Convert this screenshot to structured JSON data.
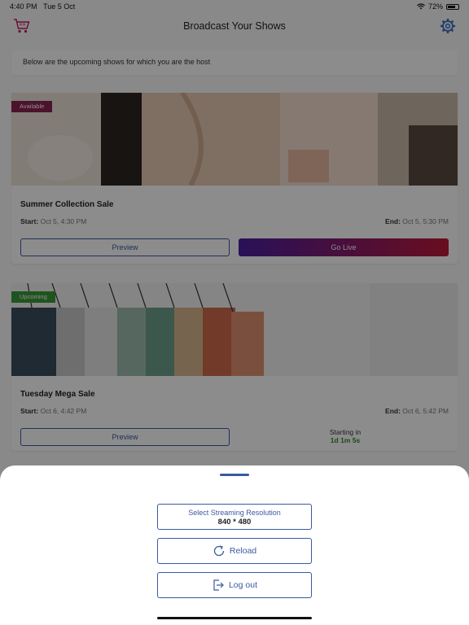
{
  "status_bar": {
    "time": "4:40 PM",
    "date": "Tue 5 Oct",
    "battery": "72%",
    "battery_level": 0.72
  },
  "header": {
    "title": "Broadcast Your Shows",
    "left_icon": "shopping-cart-icon",
    "right_icon": "gear-icon"
  },
  "intro": {
    "text": "Below are the upcoming shows for which you are the host"
  },
  "shows": [
    {
      "badge": "Available",
      "title": "Summer Collection Sale",
      "start_label": "Start:",
      "start": "Oct 5, 4:30 PM",
      "end_label": "End:",
      "end": "Oct 5, 5:30 PM",
      "preview_label": "Preview",
      "action_label": "Go Live"
    },
    {
      "badge": "Upcoming",
      "title": "Tuesday Mega Sale",
      "start_label": "Start:",
      "start": "Oct 6, 4:42 PM",
      "end_label": "End:",
      "end": "Oct 6, 5:42 PM",
      "preview_label": "Preview",
      "countdown_label": "Starting in",
      "countdown_value": "1d 1m 5s"
    }
  ],
  "sheet": {
    "resolution_label": "Select Streaming Resolution",
    "resolution_value": "840 * 480",
    "reload_label": "Reload",
    "logout_label": "Log out"
  },
  "colors": {
    "accent": "#3a5aa0",
    "available_badge": "#8a2350",
    "upcoming_badge": "#3a9a3a",
    "go_live_start": "#4a1fa0",
    "go_live_end": "#c0183a"
  }
}
